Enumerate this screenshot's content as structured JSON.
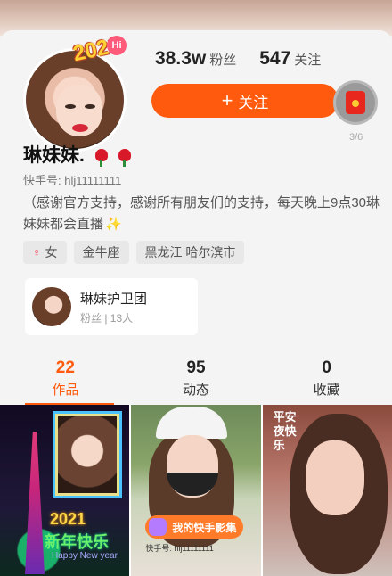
{
  "avatar": {
    "badge_year": "2021",
    "badge_hi": "Hi"
  },
  "stats": [
    {
      "num": "38.3w",
      "label": "粉丝"
    },
    {
      "num": "547",
      "label": "关注"
    }
  ],
  "follow_button": {
    "plus": "+",
    "label": "关注"
  },
  "red_packet": {
    "count": "3/6"
  },
  "profile": {
    "name": "琳妹妹.",
    "uid": "快手号: hlj11111111",
    "bio": "（感谢官方支持，感谢所有朋友们的支持，每天晚上9点30琳妹妹都会直播",
    "sparkle": "✨"
  },
  "tags": [
    {
      "icon": "female-icon",
      "label": "女"
    },
    {
      "label": "金牛座"
    },
    {
      "label": "黑龙江 哈尔滨市"
    }
  ],
  "fan_group": {
    "name": "琳妹护卫团",
    "sub": "粉丝 | 13人"
  },
  "tabs": [
    {
      "num": "22",
      "label": "作品"
    },
    {
      "num": "95",
      "label": "动态"
    },
    {
      "num": "0",
      "label": "收藏"
    }
  ],
  "grid": {
    "c1_text1": "2021",
    "c1_text2": "新年快乐",
    "c1_text3": "Happy New year",
    "c2_badge": "我的快手影集",
    "c2_id": "快手号: hlj11111111",
    "c3_text": "平安夜快乐"
  },
  "colors": {
    "accent": "#ff5a0e"
  }
}
